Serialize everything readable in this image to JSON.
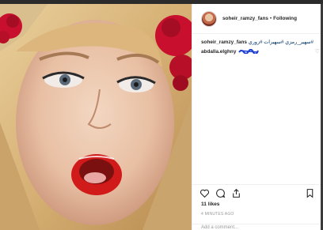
{
  "post": {
    "photo_alt": "",
    "header": {
      "username": "soheir_ramzy_fans",
      "separator": "•",
      "follow_label": "Following"
    },
    "caption": {
      "username": "soheir_ramzy_fans",
      "hashtags": "#سهير_رمزي #سهيرات #زوري"
    },
    "comment": {
      "username": "abdalla.elghny"
    },
    "likes": "11 likes",
    "timestamp": "4 MINUTES AGO",
    "add_comment_placeholder": "Add a comment..."
  },
  "icons": {
    "like": "heart-icon",
    "comment": "comment-icon",
    "share": "share-icon",
    "save": "bookmark-icon",
    "comment_like": "small-heart-icon"
  },
  "colors": {
    "text": "#262626",
    "muted": "#999999",
    "hashtag": "#003569",
    "border": "#efefef",
    "scribble": "#1a3fd1"
  }
}
